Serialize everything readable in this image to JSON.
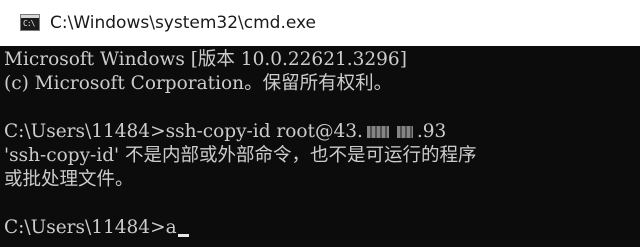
{
  "window": {
    "title": "C:\\Windows\\system32\\cmd.exe",
    "icon": "cmd-icon",
    "icon_glyph": "C:\\",
    "colors": {
      "titlebar": "#ffffff",
      "console_bg": "#0c0c0c",
      "console_text": "#cccccc"
    }
  },
  "console": {
    "banner_line1": "Microsoft Windows [版本 10.0.22621.3296]",
    "banner_line2": "(c) Microsoft Corporation。保留所有权利。",
    "command_prompt": "C:\\Users\\11484>",
    "command_pre": "ssh-copy-id root@43.",
    "command_post": ".93",
    "error_line1": "'ssh-copy-id' 不是内部或外部命令，也不是可运行的程序",
    "error_line2": "或批处理文件。",
    "current_prompt": "C:\\Users\\11484>",
    "current_input": "a"
  }
}
